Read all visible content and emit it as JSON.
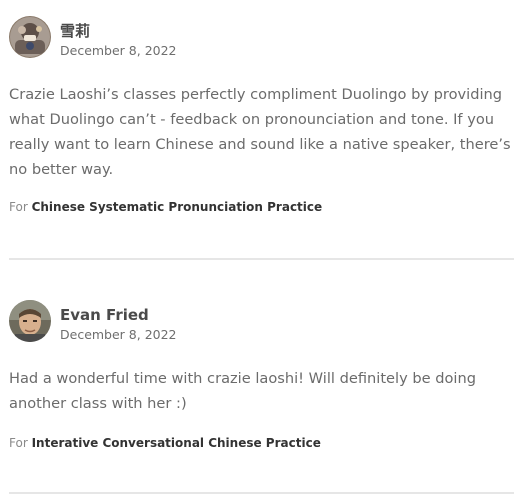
{
  "reviews": [
    {
      "author": "雪莉",
      "date": "December 8, 2022",
      "text": "Crazie Laoshi’s classes perfectly compliment Duolingo by providing what Duolingo can’t - feedback on pronounciation and tone. If you really want to learn Chinese and sound like a native speaker, there’s no better way.",
      "for_prefix": "For",
      "course": "Chinese Systematic Pronunciation Practice"
    },
    {
      "author": "Evan Fried",
      "date": "December 8, 2022",
      "text": "Had a wonderful time with crazie laoshi! Will definitely be doing another class with her :)",
      "for_prefix": "For",
      "course": "Interative Conversational Chinese Practice"
    }
  ]
}
